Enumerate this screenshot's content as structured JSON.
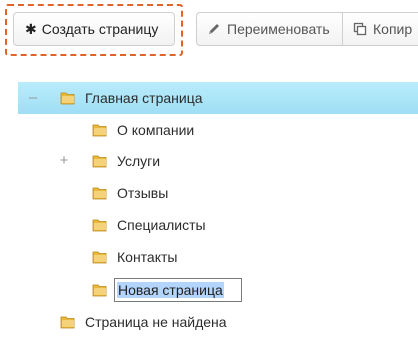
{
  "toolbar": {
    "create_label": "Создать страницу",
    "rename_label": "Переименовать",
    "copy_label": "Копир",
    "create_icon": "asterisk-icon",
    "rename_icon": "pencil-icon",
    "copy_icon": "copy-icon"
  },
  "tree": {
    "root": {
      "label": "Главная страница",
      "toggle": "–",
      "selected": true
    },
    "children": [
      {
        "label": "О компании"
      },
      {
        "label": "Услуги",
        "toggle": "+"
      },
      {
        "label": "Отзывы"
      },
      {
        "label": "Специалисты"
      },
      {
        "label": "Контакты"
      }
    ],
    "editing": {
      "value": "Новая страница"
    },
    "sibling": {
      "label": "Страница не найдена"
    }
  },
  "colors": {
    "highlight": "#e0642a",
    "selected_row": "#a8e4f8",
    "folder": "#e8b83a"
  }
}
